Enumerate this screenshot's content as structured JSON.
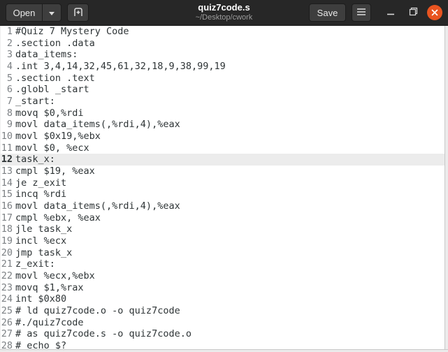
{
  "header": {
    "open_label": "Open",
    "save_label": "Save",
    "title": "quiz7code.s",
    "subtitle": "~/Desktop/cwork",
    "icons": {
      "open_dropdown": "chevron-down",
      "new_document": "tab-new-plus",
      "menu": "hamburger",
      "minimize": "minus",
      "restore": "overlapping-squares",
      "close": "x-in-circle"
    }
  },
  "editor": {
    "current_line": 12,
    "line_count": 28,
    "lines": [
      "#Quiz 7 Mystery Code",
      ".section .data",
      "data_items:",
      ".int 3,4,14,32,45,61,32,18,9,38,99,19",
      ".section .text",
      ".globl _start",
      "_start:",
      "movq $0,%rdi",
      "movl data_items(,%rdi,4),%eax",
      "movl $0x19,%ebx",
      "movl $0, %ecx",
      "task_x:",
      "cmpl $19, %eax",
      "je z_exit",
      "incq %rdi",
      "movl data_items(,%rdi,4),%eax",
      "cmpl %ebx, %eax",
      "jle task_x",
      "incl %ecx",
      "jmp task_x",
      "z_exit:",
      "movl %ecx,%ebx",
      "movq $1,%rax",
      "int $0x80",
      "# ld quiz7code.o -o quiz7code",
      "#./quiz7code",
      "# as quiz7code.s -o quiz7code.o",
      "# echo $?"
    ]
  },
  "colors": {
    "header_bg": "#272727",
    "button_bg": "#3e3e3e",
    "button_text": "#e8e8e8",
    "title_text": "#ffffff",
    "subtitle_text": "#9c9c9c",
    "close_bg": "#e95420",
    "editor_bg": "#ffffff",
    "gutter_text": "#7c8084",
    "code_text": "#2e3436",
    "current_line_bg": "#ececec"
  }
}
